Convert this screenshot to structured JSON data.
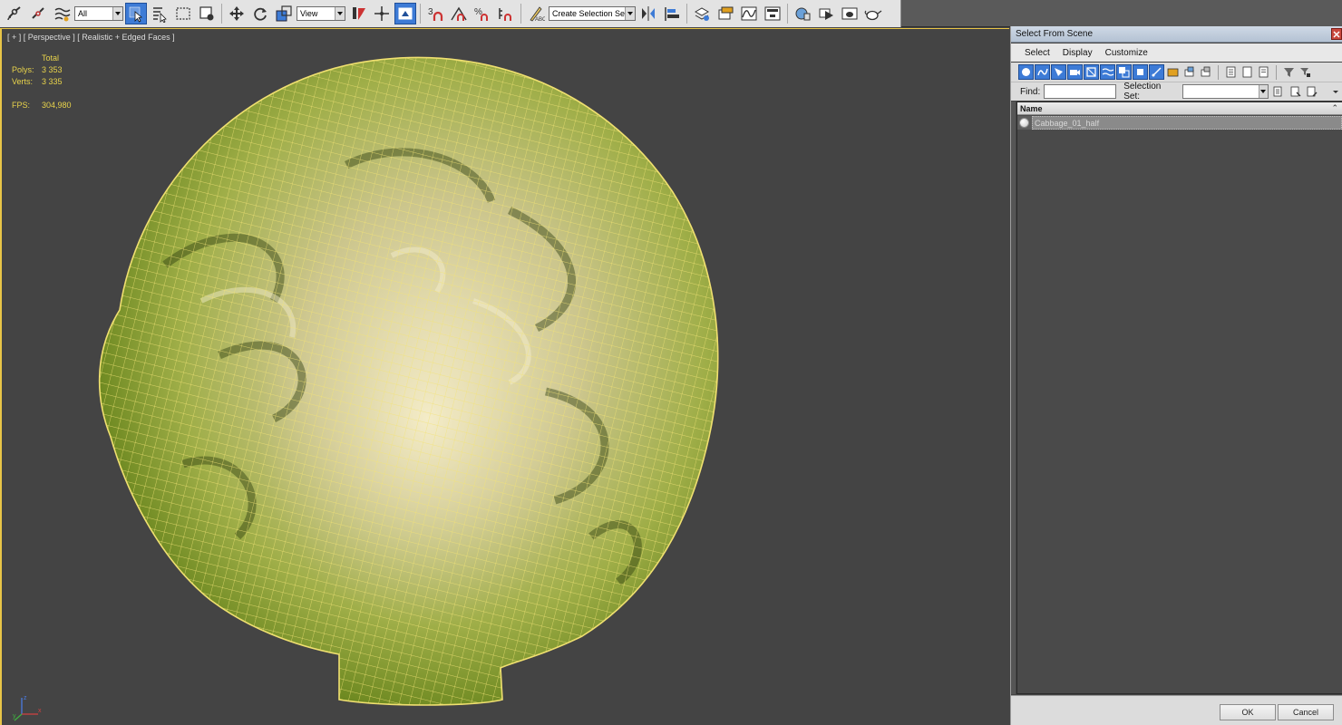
{
  "toolbar": {
    "filter_value": "All",
    "refcoord_value": "View",
    "snap_label": "3",
    "angle_label": "",
    "percent_label": "%",
    "named_selection_placeholder": "Create Selection Se"
  },
  "viewport": {
    "label": "[ + ] [ Perspective ] [ Realistic + Edged Faces ]",
    "stats": {
      "total_label": "Total",
      "polys_label": "Polys:",
      "polys_value": "3 353",
      "verts_label": "Verts:",
      "verts_value": "3 335",
      "fps_label": "FPS:",
      "fps_value": "304,980"
    },
    "axis": {
      "x": "x",
      "y": "y",
      "z": "z"
    }
  },
  "dialog": {
    "title": "Select From Scene",
    "menu": [
      "Select",
      "Display",
      "Customize"
    ],
    "find_label": "Find:",
    "find_value": "",
    "selection_set_label": "Selection Set:",
    "selection_set_value": "",
    "column_name": "Name",
    "rows": [
      {
        "name": "Cabbage_01_half"
      }
    ],
    "ok_label": "OK",
    "cancel_label": "Cancel"
  },
  "colors": {
    "accent": "#3d7bd6",
    "viewport_border": "#e8c547",
    "wire": "#f0e070",
    "stats_text": "#e8d34b"
  }
}
